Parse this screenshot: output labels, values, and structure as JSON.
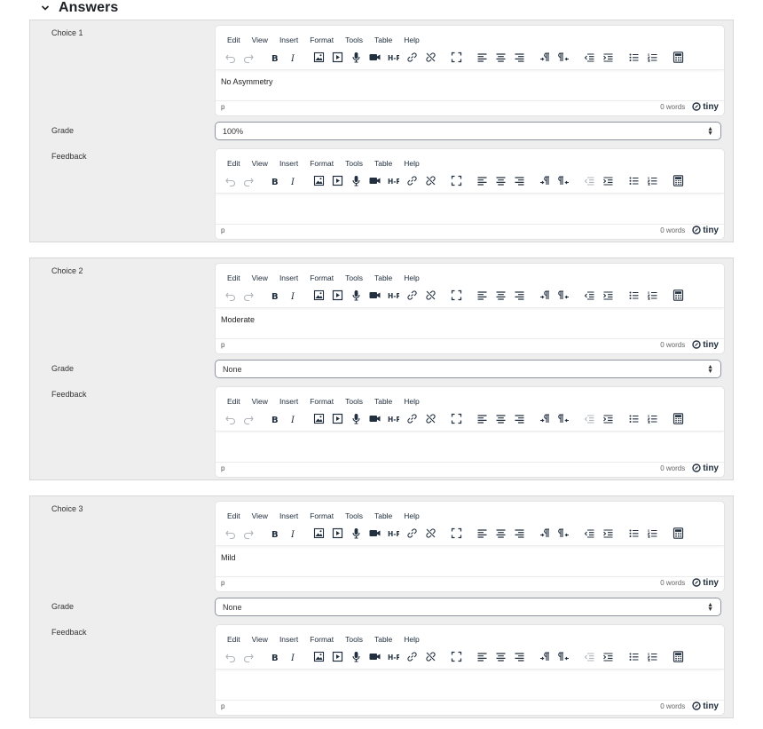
{
  "section": {
    "title": "Answers",
    "toggle_icon": "chevron-down-icon"
  },
  "editor_common": {
    "menu": [
      "Edit",
      "View",
      "Insert",
      "Format",
      "Tools",
      "Table",
      "Help"
    ],
    "path": "p",
    "word_count": "0 words",
    "brand": "tiny"
  },
  "labels": {
    "choice_1": "Choice 1",
    "choice_2": "Choice 2",
    "choice_3": "Choice 3",
    "grade": "Grade",
    "feedback": "Feedback"
  },
  "choices": [
    {
      "answer_text": "No Asymmetry",
      "grade": "100%",
      "feedback_text": ""
    },
    {
      "answer_text": "Moderate",
      "grade": "None",
      "feedback_text": ""
    },
    {
      "answer_text": "Mild",
      "grade": "None",
      "feedback_text": ""
    }
  ],
  "toolbar_icons": [
    "undo-icon",
    "redo-icon",
    "bold-icon",
    "italic-icon",
    "image-icon",
    "media-icon",
    "record-audio-icon",
    "record-video-icon",
    "h5p-icon",
    "link-icon",
    "unlink-icon",
    "fullscreen-icon",
    "align-left-icon",
    "align-center-icon",
    "align-right-icon",
    "ltr-icon",
    "rtl-icon",
    "outdent-icon",
    "indent-icon",
    "bullet-list-icon",
    "numbered-list-icon",
    "equation-icon"
  ],
  "colors": {
    "panel_bg": "#eeeeee",
    "icon": "#222f3e",
    "border": "#d7d7d7"
  }
}
